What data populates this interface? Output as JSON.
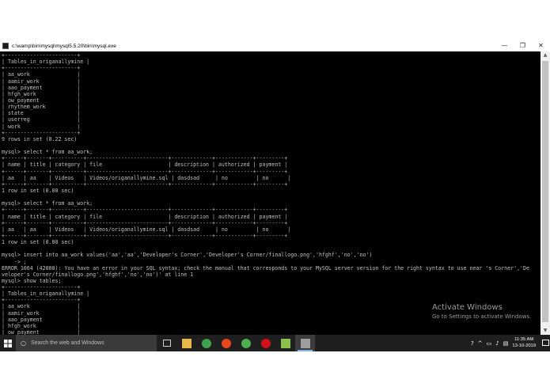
{
  "window": {
    "title": "c:\\wamp\\bin\\mysql\\mysql5.5.20\\bin\\mysql.exe",
    "controls": [
      "—",
      "❐",
      "✕"
    ]
  },
  "console": {
    "lines": [
      "+-----------------------+",
      "| Tables_in_origanallymine |",
      "+-----------------------+",
      "| aa_work               |",
      "| aamir_work            |",
      "| aao_payment           |",
      "| hfgh_work             |",
      "| ow_payment            |",
      "| rhythem_work          |",
      "| state                 |",
      "| userreg               |",
      "| work                  |",
      "+-----------------------+",
      "9 rows in set (0.22 sec)",
      "",
      "mysql> select * from aa_work;",
      "+------+-------+----------+--------------------------+-------------+------------+---------+",
      "| name | title | category | file                     | description | authorized | payment |",
      "+------+-------+----------+--------------------------+-------------+------------+---------+",
      "| aa   | aa    | Videos   | Videos/origanallymine.sql | dasdsad     | no         | no      |",
      "+------+-------+----------+--------------------------+-------------+------------+---------+",
      "1 row in set (0.00 sec)",
      "",
      "mysql> select * from aa_work;",
      "+------+-------+----------+--------------------------+-------------+------------+---------+",
      "| name | title | category | file                     | description | authorized | payment |",
      "+------+-------+----------+--------------------------+-------------+------------+---------+",
      "| aa   | aa    | Videos   | Videos/origanallymine.sql | dasdsad     | no         | no      |",
      "+------+-------+----------+--------------------------+-------------+------------+---------+",
      "1 row in set (0.00 sec)",
      "",
      "mysql> insert into aa_work values('aa','aa','Developer's Corner','Developer's Corner/finallogo.png','hfghf','no','no')",
      "    -> ;",
      "ERROR 1064 (42000): You have an error in your SQL syntax; check the manual that corresponds to your MySQL server version for the right syntax to use near 's Corner','De",
      "veloper's Corner/finallogo.png','hfghf','no','no')' at line 1",
      "mysql> show tables;",
      "+-----------------------+",
      "| Tables_in_origanallymine |",
      "+-----------------------+",
      "| aa_work               |",
      "| aamir_work            |",
      "| aao_payment           |",
      "| hfgh_work             |",
      "| ow_payment            |"
    ]
  },
  "watermark": {
    "title": "Activate Windows",
    "subtitle": "Go to Settings to activate Windows."
  },
  "taskbar": {
    "search_placeholder": "Search the web and Windows",
    "time": "11:35 AM",
    "date": "13-10-2019",
    "apps": [
      {
        "name": "task-view-icon",
        "color": "#d0d0d0"
      },
      {
        "name": "file-explorer-icon",
        "color": "#e8b84a"
      },
      {
        "name": "chrome-icon",
        "color": "#3fa34d"
      },
      {
        "name": "postman-icon",
        "color": "#e8491d"
      },
      {
        "name": "browser-icon",
        "color": "#4caf50"
      },
      {
        "name": "opera-icon",
        "color": "#d0121c"
      },
      {
        "name": "notepad-icon",
        "color": "#8bc34a"
      },
      {
        "name": "mysql-console-icon",
        "color": "#9e9e9e"
      }
    ]
  }
}
